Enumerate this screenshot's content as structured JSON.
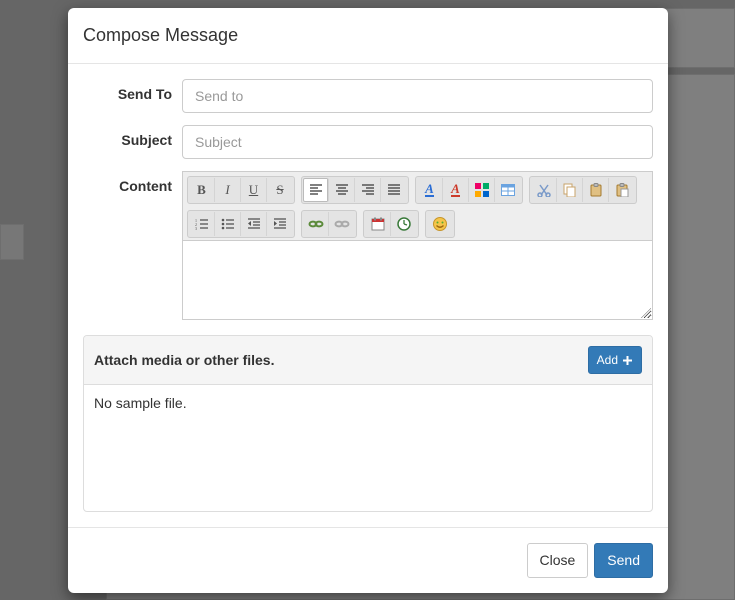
{
  "modal": {
    "title": "Compose Message"
  },
  "form": {
    "send_to": {
      "label": "Send To",
      "placeholder": "Send to",
      "value": ""
    },
    "subject": {
      "label": "Subject",
      "placeholder": "Subject",
      "value": ""
    },
    "content": {
      "label": "Content",
      "value": ""
    }
  },
  "toolbar": {
    "bold": "B",
    "italic": "I",
    "underline": "U",
    "strike": "S"
  },
  "attach": {
    "heading": "Attach media or other files.",
    "add_label": "Add",
    "empty_text": "No sample file."
  },
  "footer": {
    "close": "Close",
    "send": "Send"
  }
}
